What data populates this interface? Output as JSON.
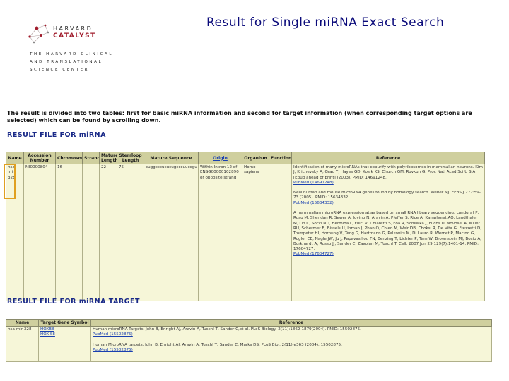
{
  "title": "Result for Single miRNA Exact Search",
  "logo": {
    "word1": "HARVARD",
    "word2": "CATALYST",
    "line1": "THE HARVARD CLINICAL",
    "line2": "AND TRANSLATIONAL",
    "line3": "SCIENCE CENTER"
  },
  "intro": "The result is divided into two tables: first for basic miRNA information and second for target information (when corresponding target options are selected) which can be found by scrolling down.",
  "mirna_section": {
    "title": "RESULT FILE FOR miRNA",
    "headers": [
      "Name",
      "Accession Number",
      "Chromosome",
      "Strand",
      "Mature Length",
      "Stemloop Length",
      "Mature Sequence",
      "Origin",
      "Organism",
      "Function",
      "Reference"
    ],
    "row": {
      "name": "hsa-mir-328",
      "accession": "MI0000804",
      "chromosome": "16",
      "strand": "-",
      "mature_length": "22",
      "stemloop_length": "75",
      "mature_sequence": "cuggcccucucugcccuuccgu",
      "origin": "Within Intron 12 of ENSG00000102890 or opposite strand",
      "organism": "Homo sapiens",
      "function": "---",
      "references": [
        {
          "text": "Identification of many microRNAs that copurify with polyribosomes in mammalian neurons. Kim J, Krichevsky A, Grad Y, Hayes GD, Kosik KS, Church GM, Ruvkun G. Proc Natl Acad Sci U S A [Epub ahead of print] (2003). PMID: 14691248.",
          "pubmed": "PubMed (14691248)"
        },
        {
          "text": "New human and mouse microRNA genes found by homology search. Weber MJ. FEBS J 272:59-73 (2005). PMID: 15634332",
          "pubmed": "PubMed (15634332)"
        },
        {
          "text": "A mammalian microRNA expression atlas based on small RNA library sequencing. Landgraf P, Rusu M, Sheridan R, Sewer A, Iovino N, Aravin A, Pfeffer S, Rice A, Kamphorst AO, Landthaler M, Lin C, Socci ND, Hermida L, Fulci V, Chiaretti S, Foa R, Schliwka J, Fuchs U, Novosel A, Miller RU, Schermer B, Bissels U, Inman J, Phan Q, Chien M, Weir DB, Choksi R, De Vita G, Frezzetti D, Trompeter HI, Hornung V, Teng G, Hartmann G, Palkovits M, Di Lauro R, Wernet P, Macino G, Rogler CE, Nagle JW, Ju J, Papavasiliou FN, Benzing T, Lichter P, Tam W, Brownstein MJ, Bosio A, Borkhardt A, Russo JJ, Sander C, Zavolan M, Tuschl T. Cell. 2007 Jun 29;129(7):1401-14. PMID: 17604727.",
          "pubmed": "PubMed (17604727)"
        }
      ]
    }
  },
  "target_section": {
    "title": "RESULT FILE FOR miRNA TARGET",
    "headers": [
      "Name",
      "Target Gene Symbol",
      "Reference"
    ],
    "row": {
      "name": "hsa-mir-328",
      "genes": [
        "HOXB8",
        "HOX-S8"
      ],
      "references": [
        {
          "text": "Human microRNA Targets. John B, Enright AJ, Aravin A, Tuschl T, Sander C,et al. PLoS Biology. 2(11):1862-1879(2004). PMID: 15502875.",
          "pubmed": "PubMed (15502875)"
        },
        {
          "text": "Human MicroRNA targets. John B, Enright AJ, Aravin A, Tuschl T, Sander C, Marks DS. PLoS Biol. 2(11):e363 (2004). 15502875.",
          "pubmed": "PubMed (15502875)"
        }
      ]
    }
  },
  "colors": {
    "title": "#0a0a7a",
    "section_title": "#1a2a88",
    "header_bg": "#cfcf9e",
    "cell_bg": "#f6f6d8",
    "link": "#1a40b0",
    "highlight": "#e0a020",
    "logo_red": "#a01c2c"
  }
}
